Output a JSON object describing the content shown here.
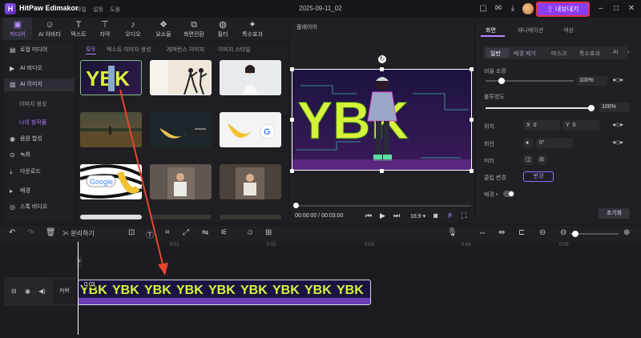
{
  "titlebar": {
    "logo": "H",
    "app_name": "HitPaw Edimakor",
    "menu": [
      "파일",
      "설정",
      "도움"
    ],
    "project": "2025-09-11_02",
    "export_label": "내보내기",
    "icons": [
      "minimize-icon",
      "maximize-icon",
      "close-icon"
    ]
  },
  "tools": [
    {
      "icon": "media-icon",
      "label": "미디어"
    },
    {
      "icon": "ai-avatar-icon",
      "label": "AI 아바타"
    },
    {
      "icon": "text-icon",
      "label": "텍스트"
    },
    {
      "icon": "caption-icon",
      "label": "자막"
    },
    {
      "icon": "audio-icon",
      "label": "오디오"
    },
    {
      "icon": "elements-icon",
      "label": "요소들"
    },
    {
      "icon": "transition-icon",
      "label": "화면전환"
    },
    {
      "icon": "filter-icon",
      "label": "필터"
    },
    {
      "icon": "effects-icon",
      "label": "특수효과"
    }
  ],
  "sidebar": {
    "items": [
      {
        "label": "로컬 미디어"
      },
      {
        "label": "AI 비디오"
      },
      {
        "label": "AI 이미지"
      }
    ],
    "sub": [
      "이미지 생성",
      "나의 창작물"
    ],
    "items2": [
      {
        "label": "음원 합성"
      },
      {
        "label": "녹화"
      },
      {
        "label": "다운로드"
      },
      {
        "label": "배경"
      },
      {
        "label": "스톡 비디오"
      }
    ]
  },
  "library": {
    "tabs": [
      "모두",
      "텍스트 이미지 생성",
      "레퍼런스 이미지",
      "이미지 스타일"
    ]
  },
  "player": {
    "title": "플레이어",
    "time": "00:00:00 / 00:03:00",
    "ratio": "16:9",
    "video_text": "YBK"
  },
  "props": {
    "tabs": [
      "화면",
      "애니메이션",
      "색상"
    ],
    "subtabs": [
      "일반",
      "배경 제거",
      "마스크",
      "특수효과",
      "AI"
    ],
    "scale_label": "비율 조정",
    "scale_value": "100%",
    "opacity_label": "불투명도",
    "opacity_value": "100%",
    "position_label": "위치",
    "pos_x_label": "X",
    "pos_x": "0",
    "pos_y_label": "Y",
    "pos_y": "0",
    "rotation_label": "회전",
    "rotation": "0°",
    "mirror_label": "미러",
    "clip_change_label": "클립 변경",
    "change_label": "변경",
    "bg_label": "배경",
    "reset_label": "초기화"
  },
  "timeline": {
    "split_label": "분리하기",
    "ticks": [
      "0:01",
      "0:02",
      "0:03",
      "0:04",
      "0:05"
    ],
    "track_label": "커버",
    "clip_label": "0:03"
  },
  "colors": {
    "accent": "#8b3cf6",
    "highlight": "#e0334d",
    "arrow": "#e8442e"
  }
}
